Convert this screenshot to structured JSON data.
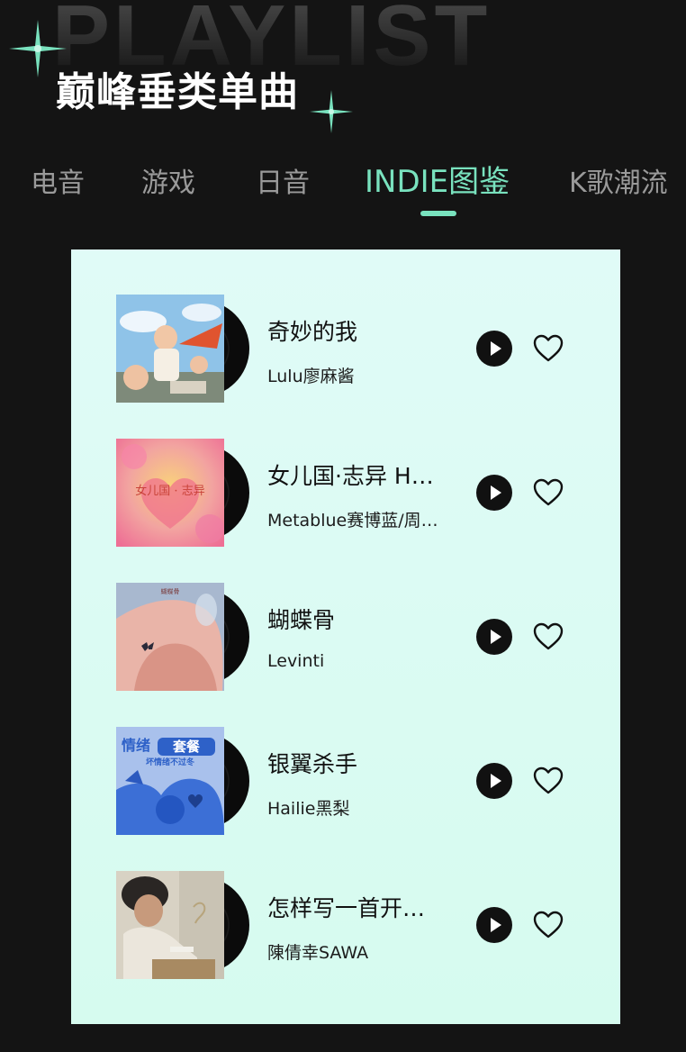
{
  "header": {
    "bg_word": "PLAYLIST",
    "title": "巅峰垂类单曲"
  },
  "tabs": [
    {
      "label": "电音",
      "active": false
    },
    {
      "label": "游戏",
      "active": false
    },
    {
      "label": "日音",
      "active": false
    },
    {
      "label": "INDIE图鉴",
      "active": true
    },
    {
      "label": "K歌潮流",
      "active": false
    }
  ],
  "colors": {
    "accent": "#79e2be",
    "background": "#141414",
    "panel": "#e0fbf7"
  },
  "songs": [
    {
      "title": "奇妙的我",
      "artist": "Lulu廖麻酱",
      "cover_text": ""
    },
    {
      "title": "女儿国·志异 H…",
      "artist": "Metablue赛博蓝/周…",
      "cover_text": "女儿国 · 志异"
    },
    {
      "title": "蝴蝶骨",
      "artist": "Levinti",
      "cover_text": "蝴蝶骨"
    },
    {
      "title": "银翼杀手",
      "artist": "Hailie黑梨",
      "cover_text": "情绪",
      "cover_text_2": "套餐",
      "cover_text_3": "坏情绪不过冬"
    },
    {
      "title": "怎样写一首开…",
      "artist": "陳倩幸SAWA",
      "cover_text": ""
    }
  ],
  "icons": {
    "play": "play-icon",
    "like": "heart-outline-icon",
    "sparkle": "sparkle-icon"
  }
}
